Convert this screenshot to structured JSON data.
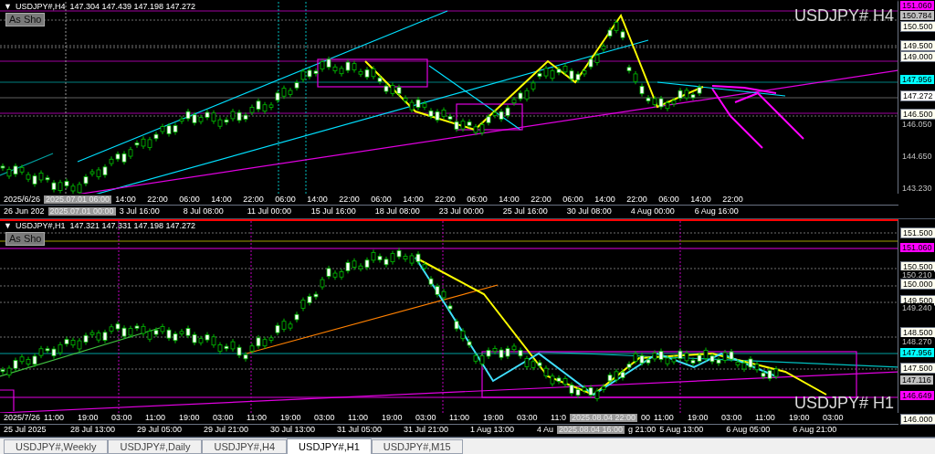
{
  "panels": [
    {
      "arrow": "▼",
      "header": "USDJPY#,H4  147.304 147.439 147.198 147.272",
      "button": "As Sho",
      "symbol": "USDJPY# H4",
      "divider": false,
      "price_labels": [
        {
          "text": "151.060",
          "kind": "magenta"
        },
        {
          "text": "150.784",
          "kind": "gray"
        },
        {
          "text": "150.500",
          "kind": "cream"
        },
        {
          "text": "149.500",
          "kind": "cream"
        },
        {
          "text": "149.000",
          "kind": "cream"
        },
        {
          "text": "147.956",
          "kind": "cyan"
        },
        {
          "text": "147.272",
          "kind": "white"
        },
        {
          "text": "146.500",
          "kind": "cream"
        },
        {
          "text": "146.050",
          "kind": "plain"
        },
        {
          "text": "144.650",
          "kind": "plain"
        },
        {
          "text": "143.230",
          "kind": "plain"
        }
      ],
      "time_rows": [
        [
          {
            "text": "2025/6/26",
            "kind": "start"
          },
          {
            "text": "2025.07.01 06:00",
            "kind": "cursor"
          },
          {
            "text": "14:00",
            "kind": "tick"
          },
          {
            "text": "22:00",
            "kind": "tick"
          },
          {
            "text": "06:00",
            "kind": "tick"
          },
          {
            "text": "14:00",
            "kind": "tick"
          },
          {
            "text": "22:00",
            "kind": "tick"
          },
          {
            "text": "06:00",
            "kind": "tick"
          },
          {
            "text": "14:00",
            "kind": "tick"
          },
          {
            "text": "22:00",
            "kind": "tick"
          },
          {
            "text": "06:00",
            "kind": "tick"
          },
          {
            "text": "14:00",
            "kind": "tick"
          },
          {
            "text": "22:00",
            "kind": "tick"
          },
          {
            "text": "06:00",
            "kind": "tick"
          },
          {
            "text": "14:00",
            "kind": "tick"
          },
          {
            "text": "22:00",
            "kind": "tick"
          },
          {
            "text": "06:00",
            "kind": "tick"
          },
          {
            "text": "14:00",
            "kind": "tick"
          },
          {
            "text": "22:00",
            "kind": "tick"
          },
          {
            "text": "06:00",
            "kind": "tick"
          },
          {
            "text": "14:00",
            "kind": "tick"
          },
          {
            "text": "22:00",
            "kind": "tick"
          }
        ],
        [
          {
            "text": "26 Jun 202",
            "kind": "start"
          },
          {
            "text": "2025.07.01 00:00",
            "kind": "cursor"
          },
          {
            "text": "3 Jul 16:00",
            "kind": "tick"
          },
          {
            "text": "8 Jul 08:00",
            "kind": "tick"
          },
          {
            "text": "11 Jul 00:00",
            "kind": "tick"
          },
          {
            "text": "15 Jul 16:00",
            "kind": "tick"
          },
          {
            "text": "18 Jul 08:00",
            "kind": "tick"
          },
          {
            "text": "23 Jul 00:00",
            "kind": "tick"
          },
          {
            "text": "25 Jul 16:00",
            "kind": "tick"
          },
          {
            "text": "30 Jul 08:00",
            "kind": "tick"
          },
          {
            "text": "4 Aug 00:00",
            "kind": "tick"
          },
          {
            "text": "6 Aug 16:00",
            "kind": "tick"
          }
        ]
      ]
    },
    {
      "arrow": "▼",
      "header": "USDJPY#,H1  147.321 147.331 147.198 147.272",
      "button": "As Sho",
      "symbol": "USDJPY# H1",
      "divider": true,
      "price_labels": [
        {
          "text": "151.500",
          "kind": "cream"
        },
        {
          "text": "151.060",
          "kind": "magenta"
        },
        {
          "text": "150.500",
          "kind": "cream"
        },
        {
          "text": "150.210",
          "kind": "plain"
        },
        {
          "text": "150.000",
          "kind": "cream"
        },
        {
          "text": "149.500",
          "kind": "cream"
        },
        {
          "text": "149.240",
          "kind": "plain"
        },
        {
          "text": "148.500",
          "kind": "cream"
        },
        {
          "text": "148.270",
          "kind": "plain"
        },
        {
          "text": "147.956",
          "kind": "cyan"
        },
        {
          "text": "147.500",
          "kind": "cream"
        },
        {
          "text": "147.116",
          "kind": "gray"
        },
        {
          "text": "146.649",
          "kind": "magenta"
        },
        {
          "text": "146.000",
          "kind": "cream"
        }
      ],
      "time_rows": [
        [
          {
            "text": "2025/7/26",
            "kind": "start"
          },
          {
            "text": "11:00",
            "kind": "tick"
          },
          {
            "text": "19:00",
            "kind": "tick"
          },
          {
            "text": "03:00",
            "kind": "tick"
          },
          {
            "text": "11:00",
            "kind": "tick"
          },
          {
            "text": "19:00",
            "kind": "tick"
          },
          {
            "text": "03:00",
            "kind": "tick"
          },
          {
            "text": "11:00",
            "kind": "tick"
          },
          {
            "text": "19:00",
            "kind": "tick"
          },
          {
            "text": "03:00",
            "kind": "tick"
          },
          {
            "text": "11:00",
            "kind": "tick"
          },
          {
            "text": "19:00",
            "kind": "tick"
          },
          {
            "text": "03:00",
            "kind": "tick"
          },
          {
            "text": "11:00",
            "kind": "tick"
          },
          {
            "text": "19:00",
            "kind": "tick"
          },
          {
            "text": "03:00",
            "kind": "tick"
          },
          {
            "text": "11:0",
            "kind": "start"
          },
          {
            "text": "2025.08.04 22:00",
            "kind": "cursor"
          },
          {
            "text": "00",
            "kind": "start"
          },
          {
            "text": "11:00",
            "kind": "tick"
          },
          {
            "text": "19:00",
            "kind": "tick"
          },
          {
            "text": "03:00",
            "kind": "tick"
          },
          {
            "text": "11:00",
            "kind": "tick"
          },
          {
            "text": "19:00",
            "kind": "tick"
          },
          {
            "text": "03:00",
            "kind": "tick"
          }
        ],
        [
          {
            "text": "25 Jul 2025",
            "kind": "tick"
          },
          {
            "text": "28 Jul 13:00",
            "kind": "tick"
          },
          {
            "text": "29 Jul 05:00",
            "kind": "tick"
          },
          {
            "text": "29 Jul 21:00",
            "kind": "tick"
          },
          {
            "text": "30 Jul 13:00",
            "kind": "tick"
          },
          {
            "text": "31 Jul 05:00",
            "kind": "tick"
          },
          {
            "text": "31 Jul 21:00",
            "kind": "tick"
          },
          {
            "text": "1 Aug 13:00",
            "kind": "tick"
          },
          {
            "text": "4 Au",
            "kind": "start"
          },
          {
            "text": "2025.08.04 16:00",
            "kind": "cursor"
          },
          {
            "text": "g 21:00",
            "kind": "start"
          },
          {
            "text": "5 Aug 13:00",
            "kind": "tick"
          },
          {
            "text": "6 Aug 05:00",
            "kind": "tick"
          },
          {
            "text": "6 Aug 21:00",
            "kind": "tick"
          }
        ]
      ]
    }
  ],
  "tabs": [
    {
      "label": "USDJPY#,Weekly",
      "selected": false
    },
    {
      "label": "USDJPY#,Daily",
      "selected": false
    },
    {
      "label": "USDJPY#,H4",
      "selected": false
    },
    {
      "label": "USDJPY#,H1",
      "selected": true
    },
    {
      "label": "USDJPY#,M15",
      "selected": false
    }
  ]
}
